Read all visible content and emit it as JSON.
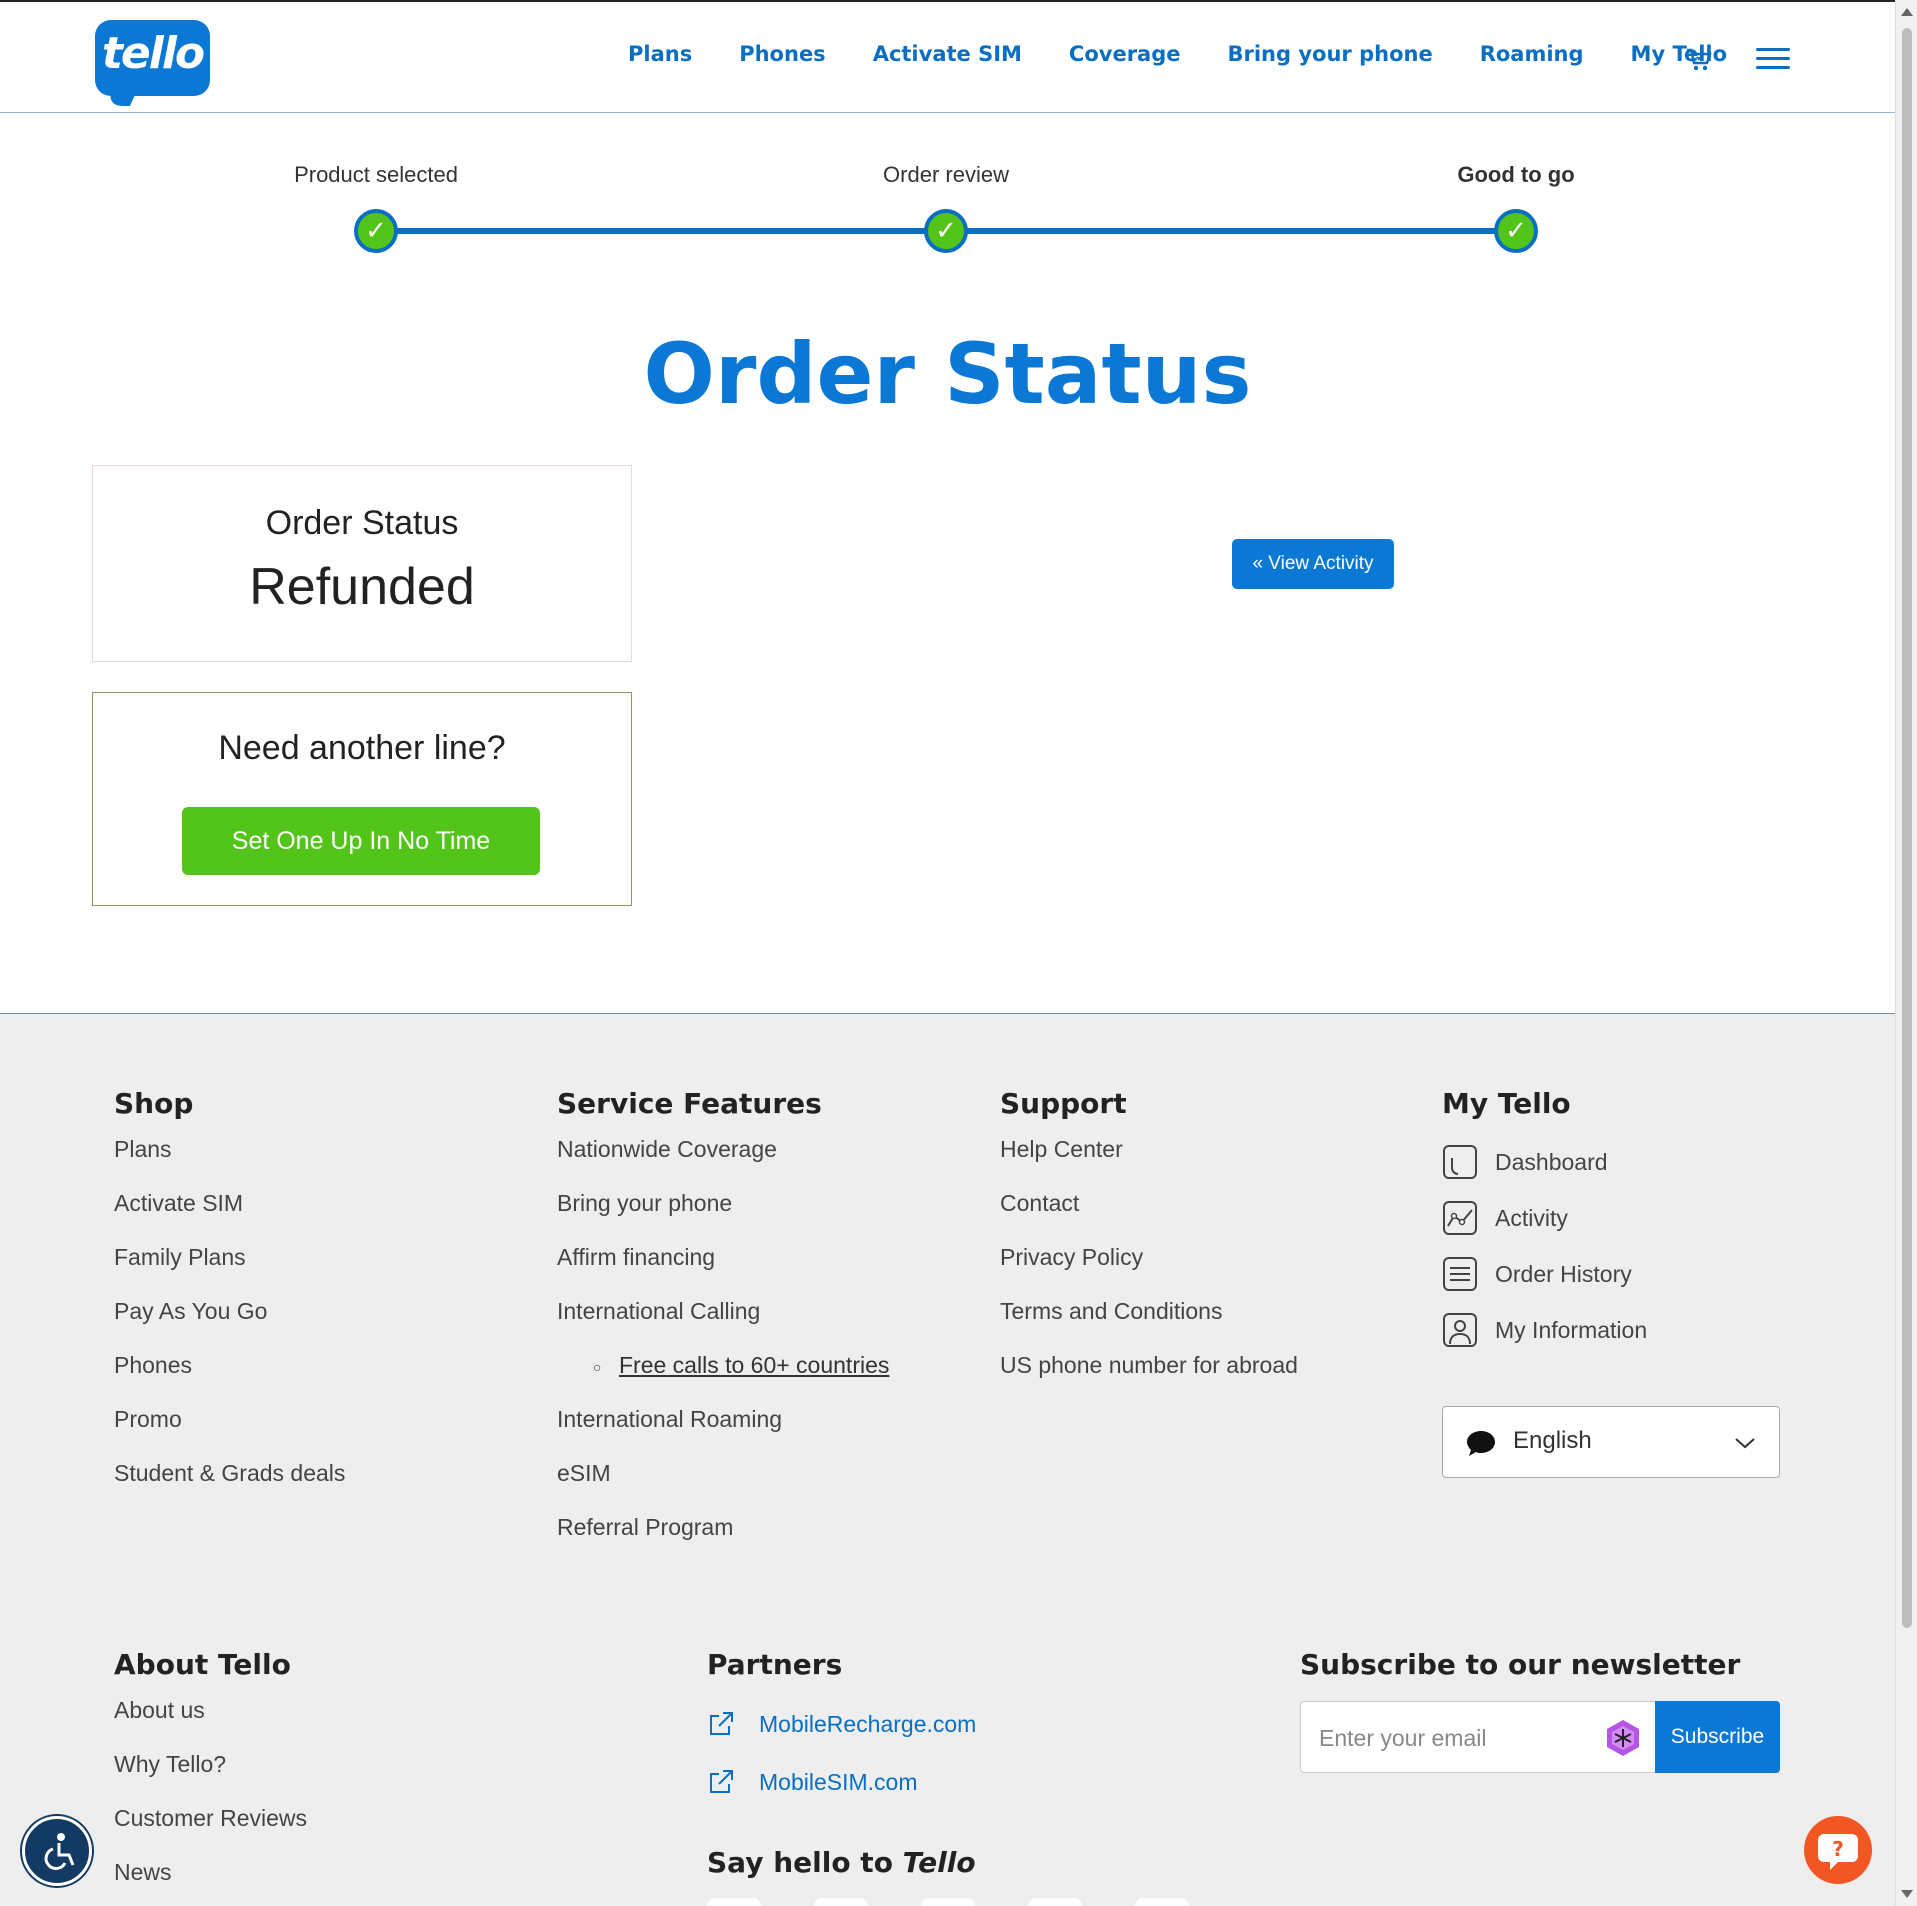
{
  "header": {
    "logo_text": "tello",
    "nav": [
      "Plans",
      "Phones",
      "Activate SIM",
      "Coverage",
      "Bring your phone",
      "Roaming",
      "My Tello"
    ],
    "cart_icon": "cart-icon",
    "menu_icon": "hamburger-menu-icon"
  },
  "progress": {
    "steps": [
      {
        "label": "Product selected",
        "done": true
      },
      {
        "label": "Order review",
        "done": true
      },
      {
        "label": "Good to go",
        "done": true,
        "current": true
      }
    ],
    "check_glyph": "✓"
  },
  "page_title": "Order Status",
  "status_card": {
    "label": "Order Status",
    "value": "Refunded"
  },
  "line_card": {
    "question": "Need another line?",
    "button": "Set One Up In No Time"
  },
  "view_activity": "« View Activity",
  "footer": {
    "shop": {
      "title": "Shop",
      "links": [
        "Plans",
        "Activate SIM",
        "Family Plans",
        "Pay As You Go",
        "Phones",
        "Promo",
        "Student & Grads deals"
      ]
    },
    "service": {
      "title": "Service Features",
      "links": [
        "Nationwide Coverage",
        "Bring your phone",
        "Affirm financing",
        "International Calling"
      ],
      "sub_link": "Free calls to 60+ countries",
      "links_after": [
        "International Roaming",
        "eSIM",
        "Referral Program"
      ]
    },
    "support": {
      "title": "Support",
      "links": [
        "Help Center",
        "Contact",
        "Privacy Policy",
        "Terms and Conditions",
        "US phone number for abroad"
      ]
    },
    "my_tello": {
      "title": "My Tello",
      "items": [
        {
          "label": "Dashboard",
          "icon": "dashboard-icon"
        },
        {
          "label": "Activity",
          "icon": "activity-chart-icon"
        },
        {
          "label": "Order History",
          "icon": "order-history-icon"
        },
        {
          "label": "My Information",
          "icon": "user-profile-icon"
        }
      ]
    },
    "language": {
      "value": "English",
      "icon": "chat-bubble-icon"
    },
    "about": {
      "title": "About Tello",
      "links": [
        "About us",
        "Why Tello?",
        "Customer Reviews",
        "News"
      ]
    },
    "partners": {
      "title": "Partners",
      "links": [
        "MobileRecharge.com",
        "MobileSIM.com"
      ]
    },
    "newsletter": {
      "title": "Subscribe to our newsletter",
      "placeholder": "Enter your email",
      "button": "Subscribe"
    },
    "say_hello": {
      "prefix": "Say hello to ",
      "brand": "Tello"
    }
  },
  "colors": {
    "brand_blue": "#0a78d4",
    "success_green": "#53c41a",
    "help_orange": "#f25622"
  }
}
